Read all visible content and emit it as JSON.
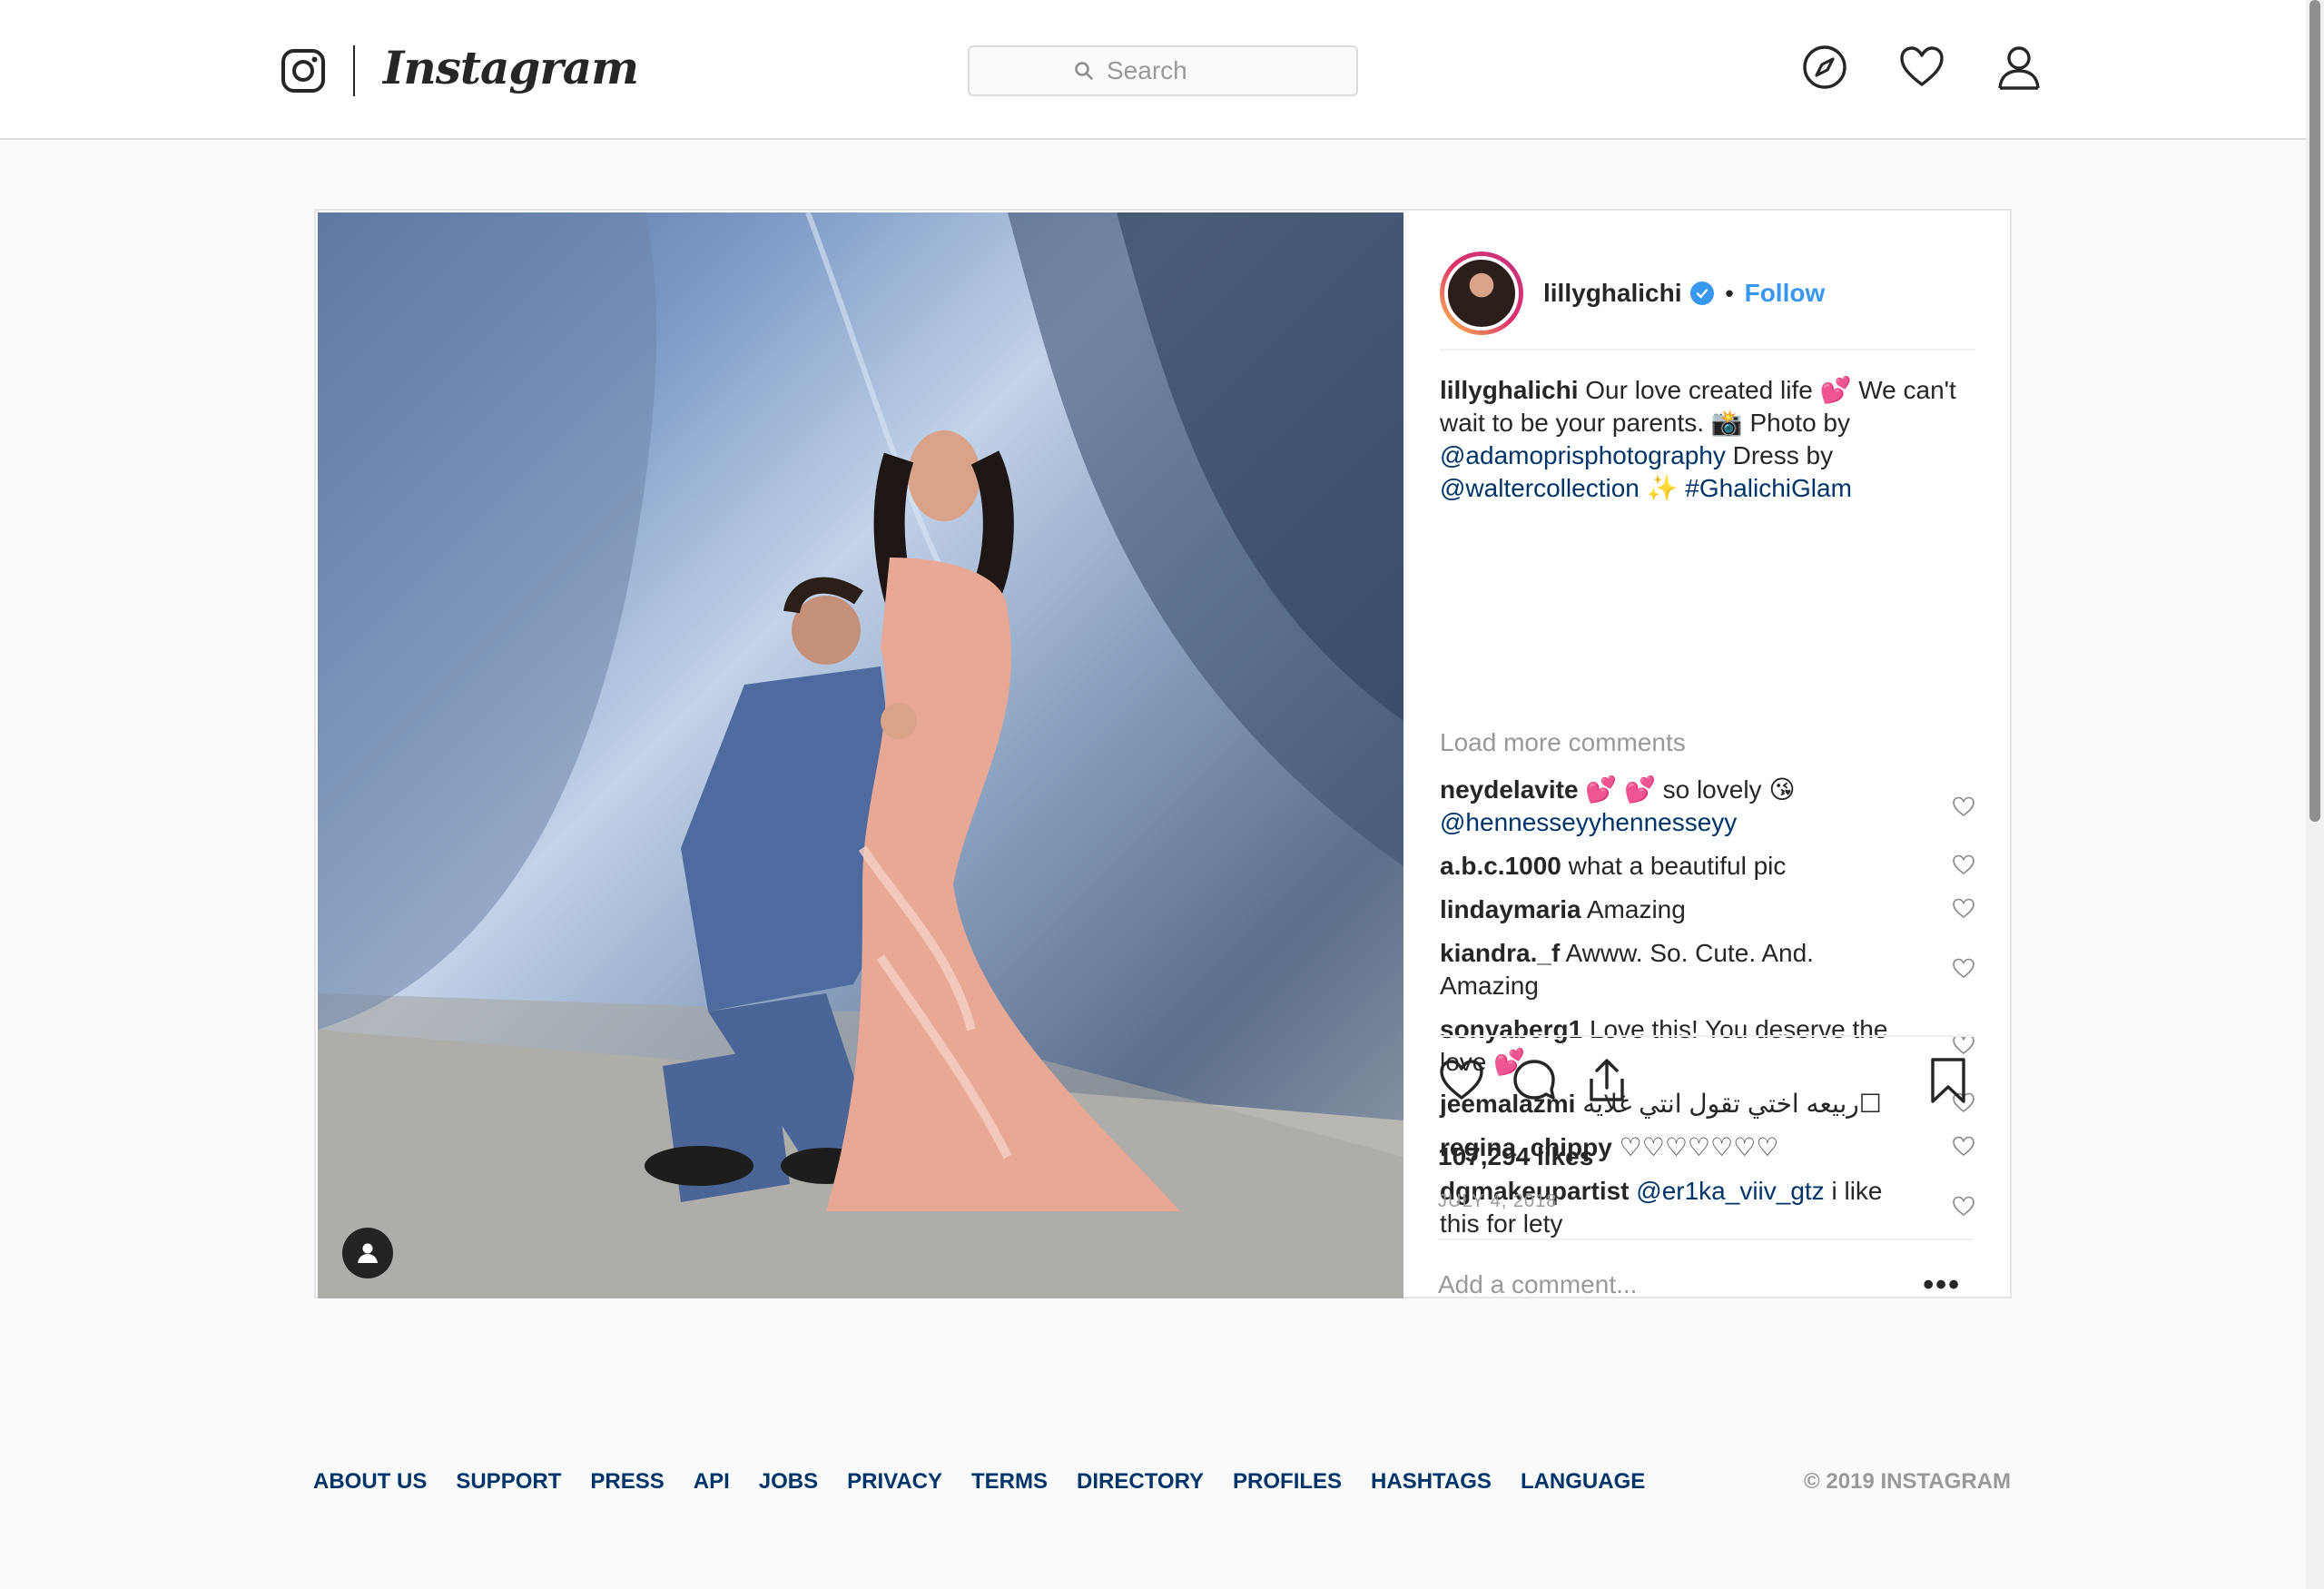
{
  "nav": {
    "wordmark": "Instagram",
    "search_placeholder": "Search",
    "icons": [
      "instagram-glyph-icon",
      "compass-icon",
      "heart-icon",
      "profile-icon"
    ]
  },
  "post": {
    "owner": "lillyghalichi",
    "follow_label": "Follow",
    "caption": {
      "user": "lillyghalichi",
      "parts": [
        {
          "text": " Our love created life 💕 We can't wait to be your parents. 📸 Photo by ",
          "type": "text"
        },
        {
          "text": "@adamoprisphotography",
          "type": "mention"
        },
        {
          "text": " Dress by ",
          "type": "text"
        },
        {
          "text": "@waltercollection",
          "type": "mention"
        },
        {
          "text": " ✨ ",
          "type": "text"
        },
        {
          "text": "#GhalichiGlam",
          "type": "mention"
        }
      ]
    },
    "load_more_label": "Load more comments",
    "comments": [
      {
        "user": "neydelavite",
        "text": " 💕 💕 so lovely 😘 ",
        "mention": "@hennesseyyhennesseyy",
        "after": ""
      },
      {
        "user": "a.b.c.1000",
        "text": " what a beautiful pic",
        "mention": "",
        "after": ""
      },
      {
        "user": "lindaymaria",
        "text": " Amazing",
        "mention": "",
        "after": ""
      },
      {
        "user": "kiandra._f",
        "text": " Awww. So. Cute. And. Amazing",
        "mention": "",
        "after": ""
      },
      {
        "user": "sonyaberg1",
        "text": " Love this! You deserve the love 💕",
        "mention": "",
        "after": ""
      },
      {
        "user": "jeemalazmi",
        "text": " ربيعه اختي تقول انتي غلايه☐",
        "mention": "",
        "after": ""
      },
      {
        "user": "regina_chippy",
        "text": " ♡♡♡♡♡♡♡",
        "mention": "",
        "after": ""
      },
      {
        "user": "dgmakeupartist",
        "text": " ",
        "mention": "@er1ka_viiv_gtz",
        "after": " i like this for lety"
      }
    ],
    "likes": "107,294 likes",
    "date": "JULY 4, 2018",
    "add_comment_placeholder": "Add a comment...",
    "more_label": "•••"
  },
  "footer": {
    "links": [
      "ABOUT US",
      "SUPPORT",
      "PRESS",
      "API",
      "JOBS",
      "PRIVACY",
      "TERMS",
      "DIRECTORY",
      "PROFILES",
      "HASHTAGS",
      "LANGUAGE"
    ],
    "copyright": "© 2019 INSTAGRAM"
  },
  "colors": {
    "link_blue": "#3897f0",
    "mention_navy": "#003569",
    "muted_gray": "#999999",
    "border": "#dbdbdb"
  }
}
